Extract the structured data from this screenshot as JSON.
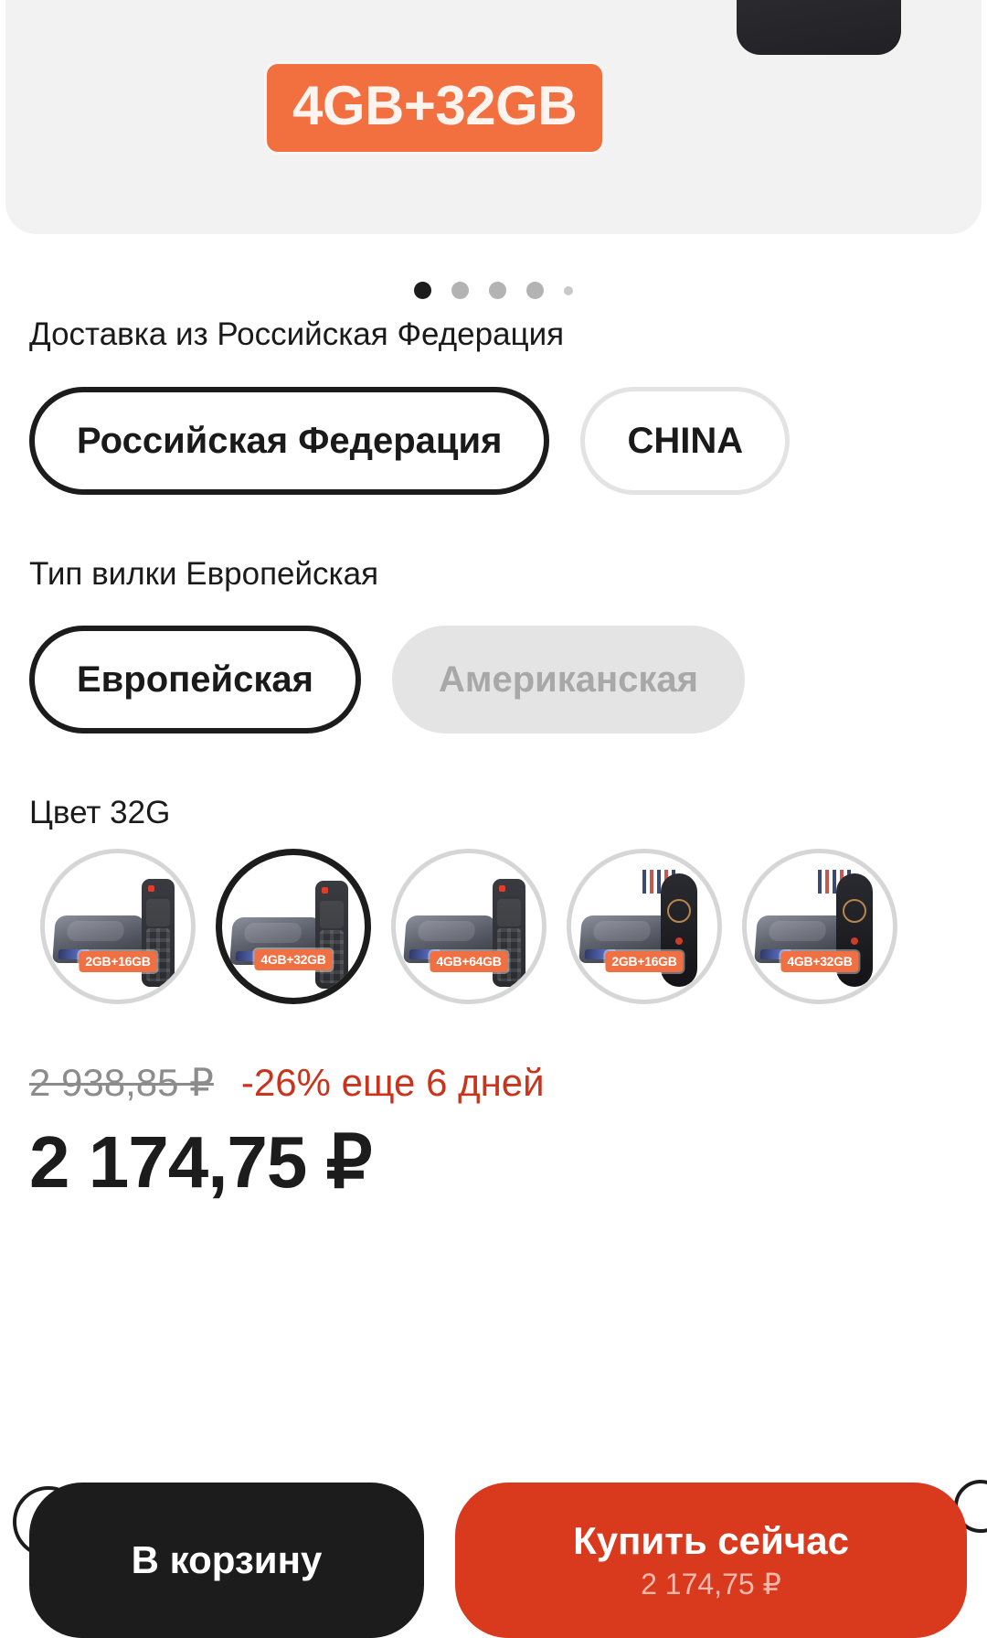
{
  "gallery": {
    "spec_badge": "4GB+32GB",
    "dots": [
      {
        "state": "active"
      },
      {
        "state": "inactive"
      },
      {
        "state": "inactive"
      },
      {
        "state": "inactive"
      },
      {
        "state": "tiny"
      }
    ]
  },
  "delivery": {
    "label": "Доставка из Российская Федерация",
    "options": [
      {
        "label": "Российская Федерация",
        "state": "selected"
      },
      {
        "label": "CHINA",
        "state": "default"
      }
    ]
  },
  "plug": {
    "label": "Тип вилки Европейская",
    "options": [
      {
        "label": "Европейская",
        "state": "selected"
      },
      {
        "label": "Американская",
        "state": "disabled"
      }
    ]
  },
  "color": {
    "label": "Цвет 32G",
    "swatches": [
      {
        "badge": "2GB+16GB",
        "state": "default",
        "art": "tvbox-remote"
      },
      {
        "badge": "4GB+32GB",
        "state": "selected",
        "art": "tvbox-remote"
      },
      {
        "badge": "4GB+64GB",
        "state": "default",
        "art": "tvbox-remote"
      },
      {
        "badge": "2GB+16GB",
        "state": "default",
        "art": "tvbox-airmouse"
      },
      {
        "badge": "4GB+32GB",
        "state": "default",
        "art": "tvbox-airmouse"
      }
    ]
  },
  "price": {
    "old": "2 938,85 ₽",
    "discount": "-26% еще 6 дней",
    "current": "2 174,75 ₽"
  },
  "actions": {
    "cart_label": "В корзину",
    "buy_label": "Купить сейчас",
    "buy_price": "2 174,75 ₽"
  },
  "colors": {
    "accent_orange": "#f2703f",
    "buy_red": "#d93a1e",
    "discount_red": "#c8341c",
    "dark": "#1c1c1c"
  }
}
